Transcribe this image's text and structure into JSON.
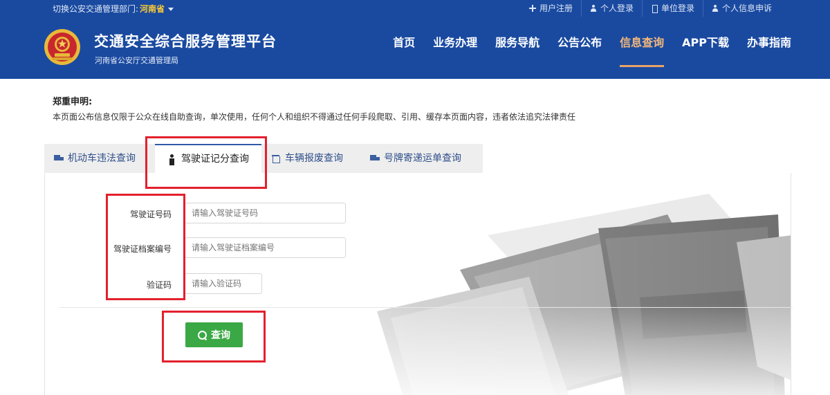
{
  "topbar": {
    "switch_prefix": "切换公安交通管理部门:",
    "province": "河南省",
    "links": [
      {
        "label": "用户注册",
        "icon": "plus-icon"
      },
      {
        "label": "个人登录",
        "icon": "user-icon"
      },
      {
        "label": "单位登录",
        "icon": "building-icon"
      },
      {
        "label": "个人信息申诉",
        "icon": "user-icon"
      }
    ]
  },
  "header": {
    "title": "交通安全综合服务管理平台",
    "subtitle": "河南省公安厅交通管理局",
    "nav": [
      {
        "label": "首页",
        "active": false
      },
      {
        "label": "业务办理",
        "active": false
      },
      {
        "label": "服务导航",
        "active": false
      },
      {
        "label": "公告公布",
        "active": false
      },
      {
        "label": "信息查询",
        "active": true
      },
      {
        "label": "APP下载",
        "active": false
      },
      {
        "label": "办事指南",
        "active": false
      }
    ]
  },
  "notice": {
    "title": "郑重申明:",
    "text": "本页面公布信息仅限于公众在线自助查询，单次使用，任何个人和组织不得通过任何手段爬取、引用、缓存本页面内容，违者依法追究法律责任"
  },
  "tabs": [
    {
      "label": "机动车违法查询",
      "icon": "truck-icon"
    },
    {
      "label": "驾驶证记分查询",
      "icon": "person-icon",
      "active": true
    },
    {
      "label": "车辆报废查询",
      "icon": "trash-icon"
    },
    {
      "label": "号牌寄递运单查询",
      "icon": "truck-icon"
    }
  ],
  "form": {
    "license_no": {
      "label": "驾驶证号码",
      "placeholder": "请输入驾驶证号码"
    },
    "archive_no": {
      "label": "驾驶证档案编号",
      "placeholder": "请输入驾驶证档案编号"
    },
    "captcha": {
      "label": "验证码",
      "placeholder": "请输入验证码"
    },
    "submit_label": "查询"
  },
  "colors": {
    "header_bg": "#1a4aa0",
    "nav_active": "#f5b97a",
    "button_green": "#3aa845",
    "highlight_red": "#e3202c",
    "province_yellow": "#ffcc33"
  }
}
